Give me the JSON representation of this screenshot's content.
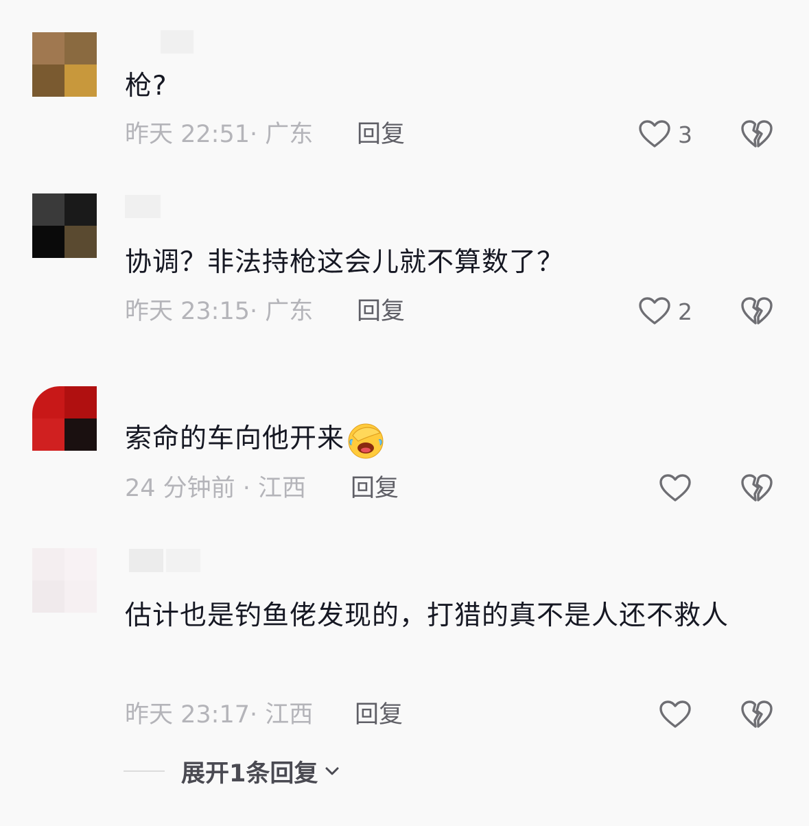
{
  "colors": {
    "text_primary": "#161823",
    "text_meta": "#b4b4b9",
    "reply": "#5f5f66",
    "icon_stroke": "#6e6e73",
    "background": "#f9f9f9"
  },
  "comments": [
    {
      "content": "枪?",
      "meta": "昨天 22:51· 广东",
      "reply_label": "回复",
      "like_count": "3",
      "avatar_palette": [
        "#a07850",
        "#8a6a40",
        "#7a5a30",
        "#c8983c"
      ]
    },
    {
      "content": "协调？非法持枪这会儿就不算数了？",
      "meta": "昨天 23:15· 广东",
      "reply_label": "回复",
      "like_count": "2",
      "avatar_palette": [
        "#3a3a3a",
        "#1a1a1a",
        "#0a0a0a",
        "#5a4a30"
      ]
    },
    {
      "content": "索命的车向他开来",
      "emoji": "facepalm-laugh-emoji",
      "meta": "24 分钟前 · 江西",
      "reply_label": "回复",
      "like_count": "",
      "avatar_palette": [
        "#c81818",
        "#b01010",
        "#d02020",
        "#1a1010"
      ]
    },
    {
      "content": "估计也是钓鱼佬发现的，打猎的真不是人还不救人",
      "meta": "昨天 23:17· 江西",
      "reply_label": "回复",
      "like_count": "",
      "avatar_palette": [
        "#f4eef0",
        "#f8f2f4",
        "#f0eaec",
        "#f6f0f2"
      ]
    }
  ],
  "expand_replies": {
    "label": "展开1条回复"
  },
  "icons": {
    "like": "heart-outline-icon",
    "dislike": "broken-heart-icon",
    "expand": "chevron-down-icon"
  }
}
